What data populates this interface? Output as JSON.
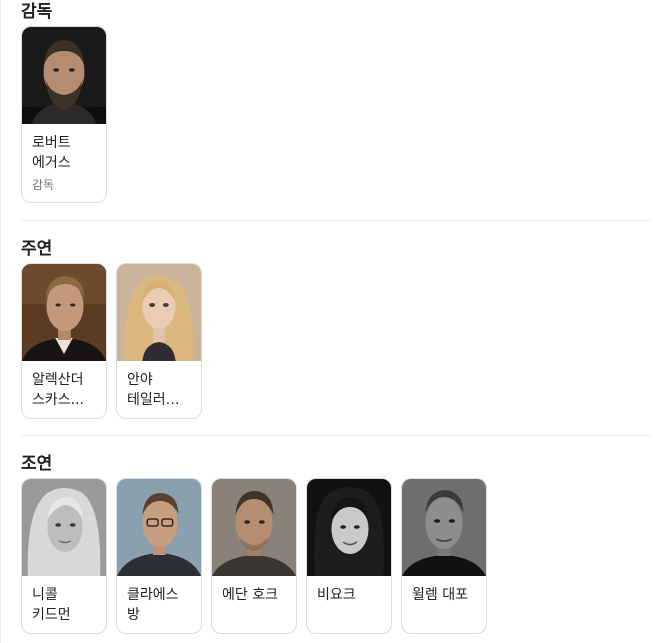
{
  "director": {
    "title": "감독",
    "cards": [
      {
        "name": "로버트 에거스",
        "role": "감독"
      }
    ]
  },
  "lead": {
    "title": "주연",
    "cards": [
      {
        "name": "알렉산더 스카스..."
      },
      {
        "name": "안야 테일러 조이"
      }
    ]
  },
  "supporting": {
    "title": "조연",
    "cards": [
      {
        "name": "니콜 키드먼"
      },
      {
        "name": "클라에스 방"
      },
      {
        "name": "에단 호크"
      },
      {
        "name": "비요크"
      },
      {
        "name": "윌렘 대포"
      }
    ]
  },
  "icons": {
    "photo": "person-photo"
  }
}
